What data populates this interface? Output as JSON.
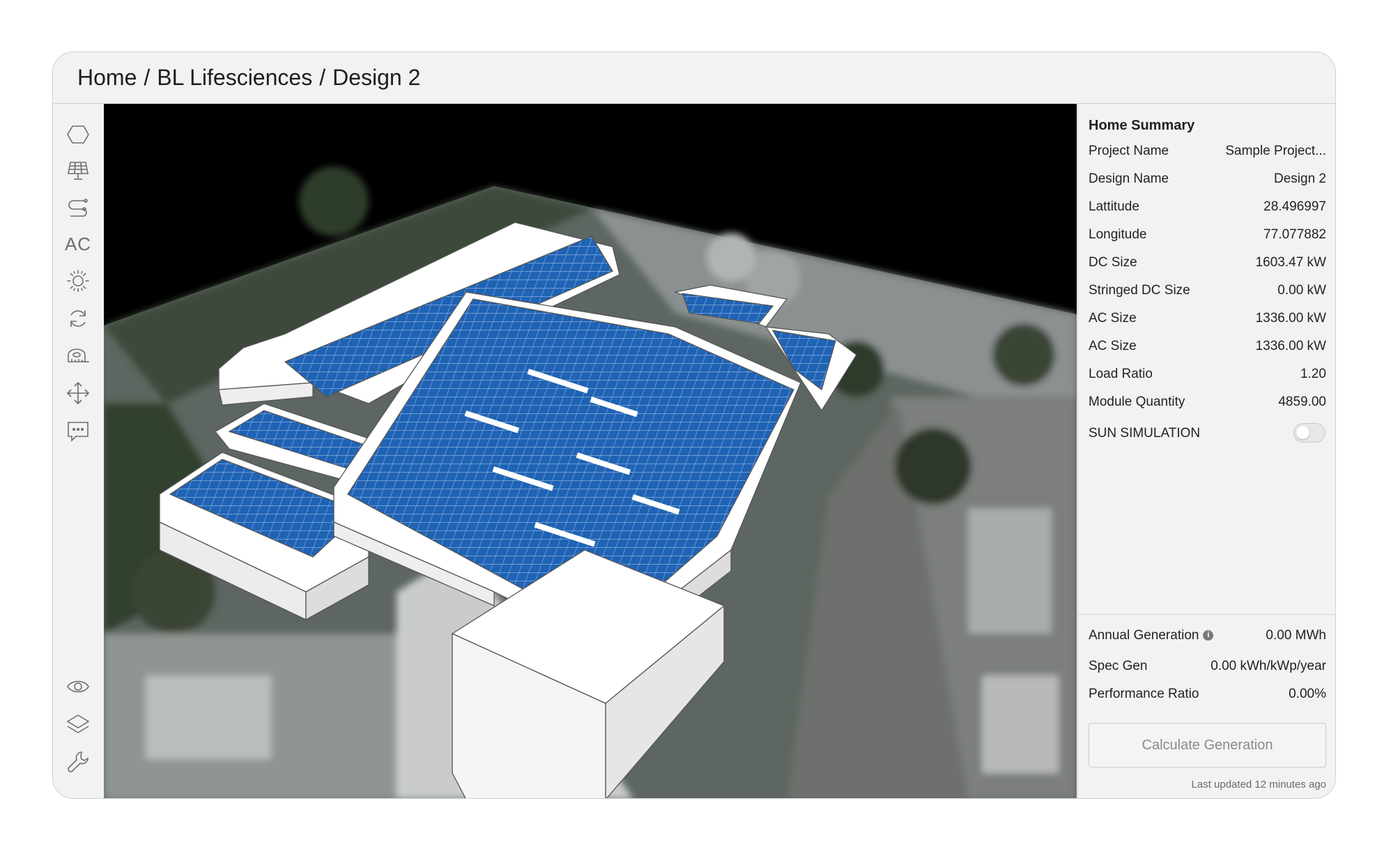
{
  "breadcrumb": {
    "home": "Home",
    "project": "BL Lifesciences",
    "design": "Design 2",
    "separator": "/"
  },
  "toolbar": {
    "ac_label": "AC",
    "tools": [
      "polygon-icon",
      "solar-panel-icon",
      "string-wiring-icon",
      "ac-tool",
      "sun-icon",
      "refresh-icon",
      "measure-tape-icon",
      "move-icon",
      "comment-icon"
    ],
    "bottom_tools": [
      "eye-icon",
      "layers-icon",
      "wrench-icon"
    ]
  },
  "summary": {
    "title": "Home Summary",
    "rows": [
      {
        "label": "Project Name",
        "value": "Sample Project..."
      },
      {
        "label": "Design Name",
        "value": "Design 2"
      },
      {
        "label": "Lattitude",
        "value": "28.496997"
      },
      {
        "label": "Longitude",
        "value": "77.077882"
      },
      {
        "label": "DC Size",
        "value": "1603.47 kW"
      },
      {
        "label": "Stringed DC Size",
        "value": "0.00 kW"
      },
      {
        "label": "AC Size",
        "value": "1336.00 kW"
      },
      {
        "label": "AC Size",
        "value": "1336.00 kW"
      },
      {
        "label": "Load Ratio",
        "value": "1.20"
      },
      {
        "label": "Module Quantity",
        "value": "4859.00"
      }
    ],
    "sun_simulation": {
      "label": "SUN SIMULATION",
      "enabled": false
    }
  },
  "generation": {
    "annual": {
      "label": "Annual Generation",
      "value": "0.00 MWh"
    },
    "spec": {
      "label": "Spec Gen",
      "value": "0.00 kWh/kWp/year"
    },
    "performance": {
      "label": "Performance Ratio",
      "value": "0.00%"
    },
    "button_label": "Calculate Generation",
    "last_updated": "Last updated 12 minutes ago"
  },
  "colors": {
    "panel_blue": "#1f63b5",
    "window_bg": "#f2f2f2",
    "border": "#cfcfcf"
  }
}
